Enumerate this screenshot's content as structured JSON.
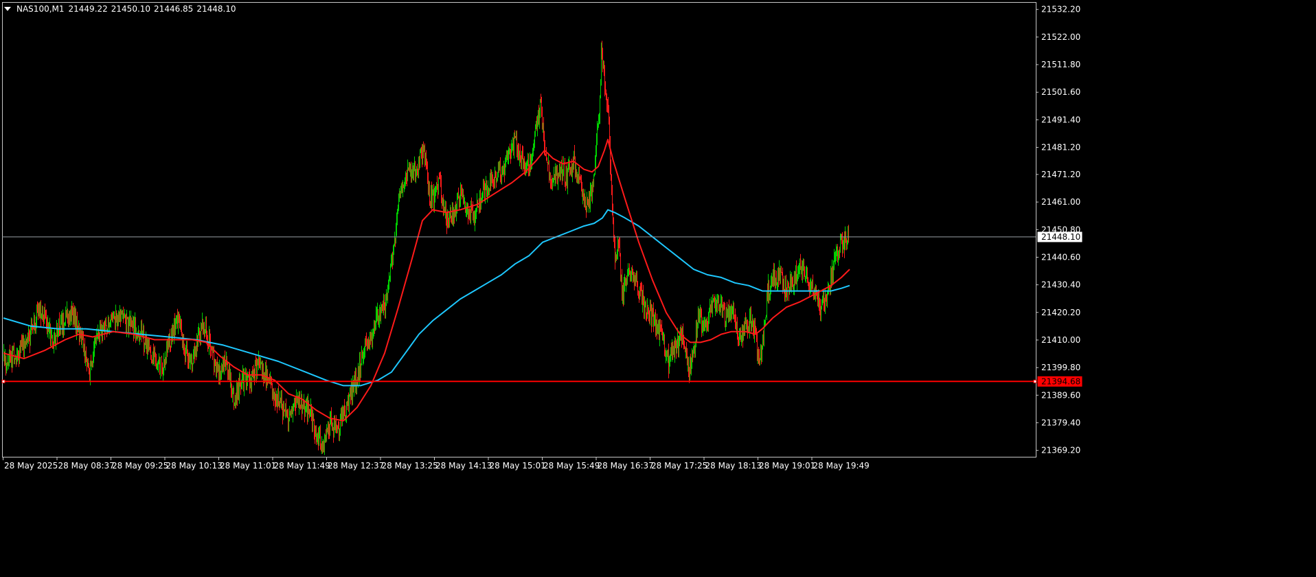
{
  "header": {
    "symbol": "NAS100,M1",
    "open": "21449.22",
    "high": "21450.10",
    "low": "21446.85",
    "close": "21448.10"
  },
  "colors": {
    "background": "#000000",
    "frame": "#c8c8c8",
    "bull_candle": "#00d000",
    "bear_candle": "#ff1a1a",
    "ma_fast": "#ff1a1a",
    "ma_slow": "#1ec8ff",
    "price_line": "#9aa0a6",
    "level_line": "#ff0000"
  },
  "price_labels": {
    "current": "21448.10",
    "level": "21394.68"
  },
  "chart_data": {
    "type": "candlestick",
    "symbol": "NAS100",
    "timeframe": "M1",
    "ylim": [
      21366.7,
      21534.8
    ],
    "y_ticks": [
      "21532.20",
      "21522.00",
      "21511.80",
      "21501.60",
      "21491.40",
      "21481.20",
      "21471.20",
      "21461.00",
      "21450.80",
      "21440.60",
      "21430.40",
      "21420.20",
      "21410.00",
      "21399.80",
      "21389.60",
      "21379.40",
      "21369.20"
    ],
    "x_ticks": [
      "28 May 2025",
      "28 May 08:37",
      "28 May 09:25",
      "28 May 10:13",
      "28 May 11:01",
      "28 May 11:49",
      "28 May 12:37",
      "28 May 13:25",
      "28 May 14:13",
      "28 May 15:01",
      "28 May 15:49",
      "28 May 16:37",
      "28 May 17:25",
      "28 May 18:13",
      "28 May 19:01",
      "28 May 19:49"
    ],
    "current_price": 21448.1,
    "horizontal_level": 21394.68,
    "close_path": [
      [
        0,
        21402
      ],
      [
        20,
        21404
      ],
      [
        40,
        21412
      ],
      [
        50,
        21420
      ],
      [
        60,
        21418
      ],
      [
        70,
        21410
      ],
      [
        80,
        21414
      ],
      [
        90,
        21418
      ],
      [
        100,
        21420
      ],
      [
        110,
        21412
      ],
      [
        120,
        21405
      ],
      [
        125,
        21398
      ],
      [
        135,
        21410
      ],
      [
        150,
        21415
      ],
      [
        170,
        21418
      ],
      [
        190,
        21414
      ],
      [
        200,
        21412
      ],
      [
        215,
        21404
      ],
      [
        230,
        21400
      ],
      [
        245,
        21412
      ],
      [
        255,
        21418
      ],
      [
        265,
        21404
      ],
      [
        275,
        21404
      ],
      [
        290,
        21416
      ],
      [
        300,
        21408
      ],
      [
        310,
        21398
      ],
      [
        325,
        21402
      ],
      [
        335,
        21388
      ],
      [
        345,
        21394
      ],
      [
        360,
        21396
      ],
      [
        370,
        21400
      ],
      [
        385,
        21396
      ],
      [
        395,
        21390
      ],
      [
        405,
        21385
      ],
      [
        415,
        21382
      ],
      [
        425,
        21388
      ],
      [
        435,
        21386
      ],
      [
        445,
        21384
      ],
      [
        455,
        21375
      ],
      [
        465,
        21372
      ],
      [
        475,
        21380
      ],
      [
        485,
        21376
      ],
      [
        495,
        21383
      ],
      [
        505,
        21390
      ],
      [
        515,
        21396
      ],
      [
        525,
        21408
      ],
      [
        535,
        21412
      ],
      [
        545,
        21418
      ],
      [
        555,
        21424
      ],
      [
        565,
        21440
      ],
      [
        570,
        21450
      ],
      [
        575,
        21462
      ],
      [
        585,
        21470
      ],
      [
        595,
        21472
      ],
      [
        605,
        21476
      ],
      [
        612,
        21480
      ],
      [
        618,
        21465
      ],
      [
        625,
        21462
      ],
      [
        635,
        21468
      ],
      [
        645,
        21454
      ],
      [
        655,
        21458
      ],
      [
        665,
        21464
      ],
      [
        675,
        21458
      ],
      [
        685,
        21455
      ],
      [
        695,
        21462
      ],
      [
        705,
        21466
      ],
      [
        715,
        21470
      ],
      [
        725,
        21472
      ],
      [
        735,
        21478
      ],
      [
        745,
        21484
      ],
      [
        755,
        21476
      ],
      [
        765,
        21472
      ],
      [
        775,
        21488
      ],
      [
        782,
        21496
      ],
      [
        790,
        21476
      ],
      [
        800,
        21468
      ],
      [
        810,
        21474
      ],
      [
        820,
        21470
      ],
      [
        830,
        21476
      ],
      [
        840,
        21465
      ],
      [
        850,
        21460
      ],
      [
        858,
        21468
      ],
      [
        866,
        21490
      ],
      [
        870,
        21515
      ],
      [
        875,
        21505
      ],
      [
        880,
        21495
      ],
      [
        884,
        21470
      ],
      [
        890,
        21438
      ],
      [
        895,
        21448
      ],
      [
        900,
        21426
      ],
      [
        910,
        21436
      ],
      [
        920,
        21432
      ],
      [
        930,
        21424
      ],
      [
        940,
        21420
      ],
      [
        950,
        21415
      ],
      [
        960,
        21410
      ],
      [
        968,
        21402
      ],
      [
        978,
        21408
      ],
      [
        988,
        21412
      ],
      [
        998,
        21398
      ],
      [
        1005,
        21405
      ],
      [
        1012,
        21420
      ],
      [
        1020,
        21414
      ],
      [
        1030,
        21422
      ],
      [
        1040,
        21426
      ],
      [
        1050,
        21418
      ],
      [
        1060,
        21422
      ],
      [
        1070,
        21410
      ],
      [
        1080,
        21415
      ],
      [
        1090,
        21418
      ],
      [
        1100,
        21402
      ],
      [
        1105,
        21408
      ],
      [
        1112,
        21428
      ],
      [
        1120,
        21432
      ],
      [
        1130,
        21434
      ],
      [
        1140,
        21428
      ],
      [
        1150,
        21432
      ],
      [
        1160,
        21438
      ],
      [
        1170,
        21432
      ],
      [
        1180,
        21428
      ],
      [
        1190,
        21422
      ],
      [
        1200,
        21426
      ],
      [
        1210,
        21440
      ],
      [
        1220,
        21445
      ],
      [
        1230,
        21448.1
      ]
    ],
    "ma_fast": [
      [
        0,
        21405
      ],
      [
        30,
        21403
      ],
      [
        60,
        21406
      ],
      [
        90,
        21410
      ],
      [
        110,
        21412
      ],
      [
        130,
        21411
      ],
      [
        160,
        21413
      ],
      [
        190,
        21412
      ],
      [
        220,
        21410
      ],
      [
        250,
        21410
      ],
      [
        275,
        21410
      ],
      [
        295,
        21409
      ],
      [
        315,
        21404
      ],
      [
        335,
        21400
      ],
      [
        355,
        21397
      ],
      [
        375,
        21397
      ],
      [
        395,
        21395
      ],
      [
        415,
        21390
      ],
      [
        435,
        21388
      ],
      [
        455,
        21384
      ],
      [
        475,
        21381
      ],
      [
        495,
        21380
      ],
      [
        515,
        21385
      ],
      [
        535,
        21393
      ],
      [
        555,
        21405
      ],
      [
        575,
        21422
      ],
      [
        595,
        21440
      ],
      [
        610,
        21454
      ],
      [
        625,
        21458
      ],
      [
        645,
        21457
      ],
      [
        665,
        21458
      ],
      [
        690,
        21460
      ],
      [
        715,
        21464
      ],
      [
        740,
        21468
      ],
      [
        760,
        21472
      ],
      [
        775,
        21476
      ],
      [
        788,
        21480
      ],
      [
        800,
        21477
      ],
      [
        815,
        21475
      ],
      [
        830,
        21476
      ],
      [
        845,
        21473
      ],
      [
        857,
        21472
      ],
      [
        866,
        21474
      ],
      [
        875,
        21480
      ],
      [
        880,
        21484
      ],
      [
        888,
        21476
      ],
      [
        905,
        21462
      ],
      [
        925,
        21446
      ],
      [
        945,
        21432
      ],
      [
        965,
        21420
      ],
      [
        985,
        21412
      ],
      [
        1000,
        21409
      ],
      [
        1015,
        21409
      ],
      [
        1030,
        21410
      ],
      [
        1045,
        21412
      ],
      [
        1060,
        21413
      ],
      [
        1080,
        21413
      ],
      [
        1095,
        21412
      ],
      [
        1105,
        21414
      ],
      [
        1120,
        21418
      ],
      [
        1140,
        21422
      ],
      [
        1160,
        21424
      ],
      [
        1175,
        21426
      ],
      [
        1190,
        21428
      ],
      [
        1205,
        21430
      ],
      [
        1220,
        21433
      ],
      [
        1232,
        21436
      ]
    ],
    "ma_slow": [
      [
        0,
        21418
      ],
      [
        40,
        21415
      ],
      [
        80,
        21414
      ],
      [
        120,
        21414
      ],
      [
        160,
        21413
      ],
      [
        200,
        21412
      ],
      [
        240,
        21411
      ],
      [
        280,
        21410
      ],
      [
        320,
        21408
      ],
      [
        360,
        21405
      ],
      [
        400,
        21402
      ],
      [
        440,
        21398
      ],
      [
        470,
        21395
      ],
      [
        495,
        21393
      ],
      [
        520,
        21393
      ],
      [
        545,
        21395
      ],
      [
        565,
        21398
      ],
      [
        585,
        21405
      ],
      [
        605,
        21412
      ],
      [
        625,
        21417
      ],
      [
        645,
        21421
      ],
      [
        665,
        21425
      ],
      [
        685,
        21428
      ],
      [
        705,
        21431
      ],
      [
        725,
        21434
      ],
      [
        745,
        21438
      ],
      [
        765,
        21441
      ],
      [
        785,
        21446
      ],
      [
        805,
        21448
      ],
      [
        825,
        21450
      ],
      [
        845,
        21452
      ],
      [
        860,
        21453
      ],
      [
        872,
        21455
      ],
      [
        880,
        21458
      ],
      [
        890,
        21457
      ],
      [
        905,
        21455
      ],
      [
        925,
        21452
      ],
      [
        945,
        21448
      ],
      [
        965,
        21444
      ],
      [
        985,
        21440
      ],
      [
        1005,
        21436
      ],
      [
        1025,
        21434
      ],
      [
        1045,
        21433
      ],
      [
        1065,
        21431
      ],
      [
        1085,
        21430
      ],
      [
        1105,
        21428
      ],
      [
        1125,
        21428
      ],
      [
        1145,
        21428
      ],
      [
        1165,
        21428
      ],
      [
        1185,
        21428
      ],
      [
        1205,
        21428
      ],
      [
        1220,
        21429
      ],
      [
        1232,
        21430
      ]
    ]
  }
}
